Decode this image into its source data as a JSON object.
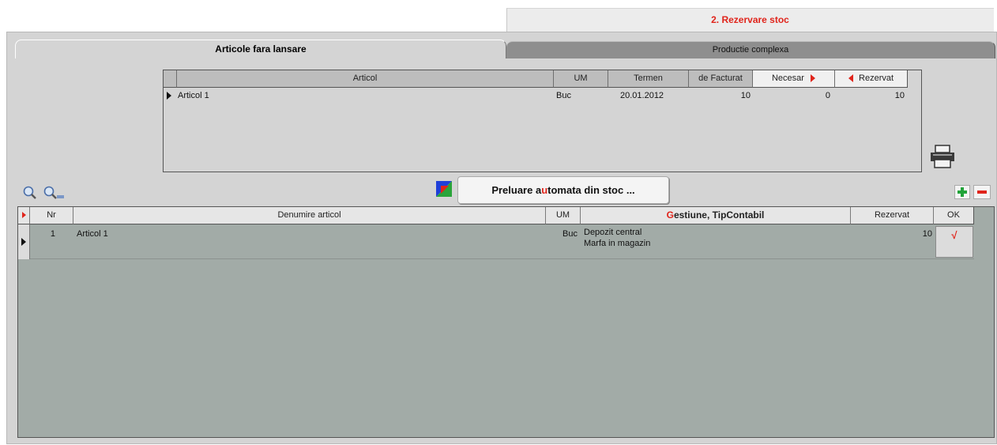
{
  "step": {
    "title": "2. Rezervare stoc"
  },
  "tabs": [
    {
      "label": "Articole fara lansare",
      "active": true
    },
    {
      "label": "Productie complexa",
      "active": false
    }
  ],
  "top_grid": {
    "headers": [
      "Articol",
      "UM",
      "Termen",
      "de Facturat",
      "Necesar",
      "Rezervat"
    ],
    "rows": [
      {
        "articol": "Articol 1",
        "um": "Buc",
        "termen": "20.01.2012",
        "de_facturat": "10",
        "necesar": "0",
        "rezervat": "10"
      }
    ]
  },
  "toolbar": {
    "preluare": {
      "pre": "Preluare ",
      "accent": "a",
      "mid": "u",
      "rest": "tomata din stoc ..."
    },
    "accent_color": "#e0241b"
  },
  "bottom_grid": {
    "headers": {
      "nr": "Nr",
      "denumire": "Denumire articol",
      "um": "UM",
      "gestiune_accent": "G",
      "gestiune_rest": "estiune, TipContabil",
      "rezervat": "Rezervat",
      "ok": "OK"
    },
    "rows": [
      {
        "nr": "1",
        "denumire": "Articol 1",
        "um": "Buc",
        "gestiune": "Depozit central",
        "tip_contabil": "Marfa in magazin",
        "rezervat": "10",
        "ok": "√"
      }
    ]
  },
  "icons": [
    "search-icon",
    "search-advanced-icon",
    "print-icon",
    "color-picker-icon",
    "add-icon",
    "remove-icon"
  ]
}
